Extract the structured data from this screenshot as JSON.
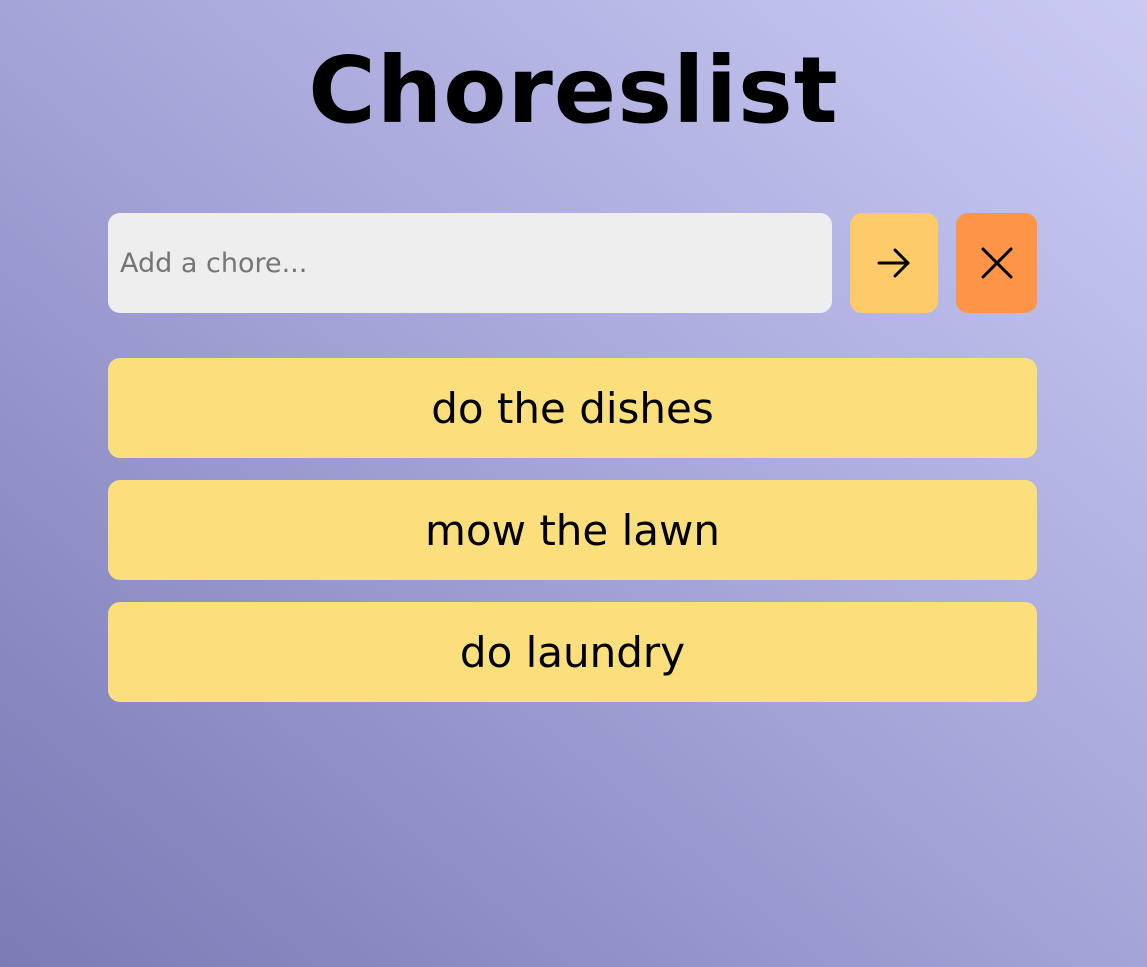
{
  "app": {
    "title": "Choreslist"
  },
  "input": {
    "placeholder": "Add a chore...",
    "value": ""
  },
  "buttons": {
    "add_icon": "arrow-right-icon",
    "clear_icon": "close-icon"
  },
  "chores": [
    {
      "label": "do the dishes"
    },
    {
      "label": "mow the lawn"
    },
    {
      "label": "do laundry"
    }
  ],
  "colors": {
    "background_start": "#7b7bb6",
    "background_end": "#cacbf4",
    "input_bg": "#eeeeee",
    "add_button": "#fecb6b",
    "clear_button": "#fe9447",
    "chore_item": "#fbdf7d"
  }
}
